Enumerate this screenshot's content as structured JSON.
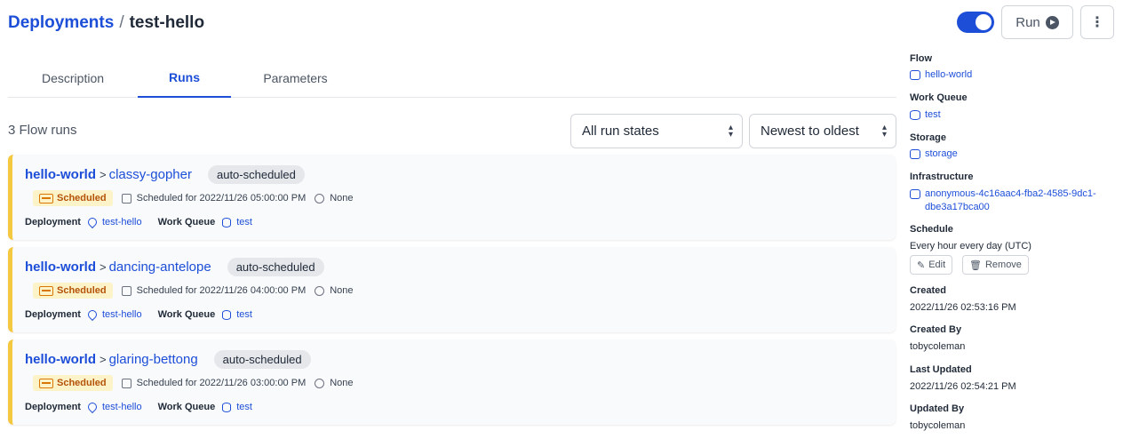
{
  "breadcrumb": {
    "parent": "Deployments",
    "separator": "/",
    "current": "test-hello"
  },
  "actions": {
    "toggle_on": true,
    "run_label": "Run",
    "more_label": "⋮"
  },
  "tabs": [
    {
      "label": "Description",
      "active": false
    },
    {
      "label": "Runs",
      "active": true
    },
    {
      "label": "Parameters",
      "active": false
    }
  ],
  "runs": {
    "count_label": "3 Flow runs",
    "state_filter": "All run states",
    "sort": "Newest to oldest",
    "items": [
      {
        "flow": "hello-world",
        "name": "classy-gopher",
        "tag": "auto-scheduled",
        "state": "Scheduled",
        "scheduled": "Scheduled for 2022/11/26 05:00:00 PM",
        "duration": "None",
        "deployment_label": "Deployment",
        "deployment": "test-hello",
        "work_queue_label": "Work Queue",
        "work_queue": "test"
      },
      {
        "flow": "hello-world",
        "name": "dancing-antelope",
        "tag": "auto-scheduled",
        "state": "Scheduled",
        "scheduled": "Scheduled for 2022/11/26 04:00:00 PM",
        "duration": "None",
        "deployment_label": "Deployment",
        "deployment": "test-hello",
        "work_queue_label": "Work Queue",
        "work_queue": "test"
      },
      {
        "flow": "hello-world",
        "name": "glaring-bettong",
        "tag": "auto-scheduled",
        "state": "Scheduled",
        "scheduled": "Scheduled for 2022/11/26 03:00:00 PM",
        "duration": "None",
        "deployment_label": "Deployment",
        "deployment": "test-hello",
        "work_queue_label": "Work Queue",
        "work_queue": "test"
      }
    ]
  },
  "sidebar": {
    "flow_label": "Flow",
    "flow": "hello-world",
    "work_queue_label": "Work Queue",
    "work_queue": "test",
    "storage_label": "Storage",
    "storage": "storage",
    "infrastructure_label": "Infrastructure",
    "infrastructure": "anonymous-4c16aac4-fba2-4585-9dc1-dbe3a17bca00",
    "schedule_label": "Schedule",
    "schedule": "Every hour every day (UTC)",
    "edit_label": "Edit",
    "remove_label": "Remove",
    "created_label": "Created",
    "created": "2022/11/26 02:53:16 PM",
    "created_by_label": "Created By",
    "created_by": "tobycoleman",
    "last_updated_label": "Last Updated",
    "last_updated": "2022/11/26 02:54:21 PM",
    "updated_by_label": "Updated By",
    "updated_by": "tobycoleman"
  },
  "colors": {
    "accent": "#1d4ed8",
    "scheduled_bar": "#f5c842",
    "scheduled_badge_bg": "#fdf3c8",
    "scheduled_badge_text": "#b45309"
  },
  "icons": {
    "run": "play-circle-icon",
    "more": "vertical-dots-icon",
    "state": "scheduled-icon",
    "calendar": "calendar-icon",
    "clock": "clock-icon",
    "deployment": "location-pin-icon",
    "work_queue": "database-icon",
    "flow": "flow-icon",
    "storage": "cube-icon",
    "infrastructure": "cube-icon",
    "edit": "pencil-icon",
    "remove": "trash-icon",
    "sort": "chevron-up-down-icon"
  }
}
